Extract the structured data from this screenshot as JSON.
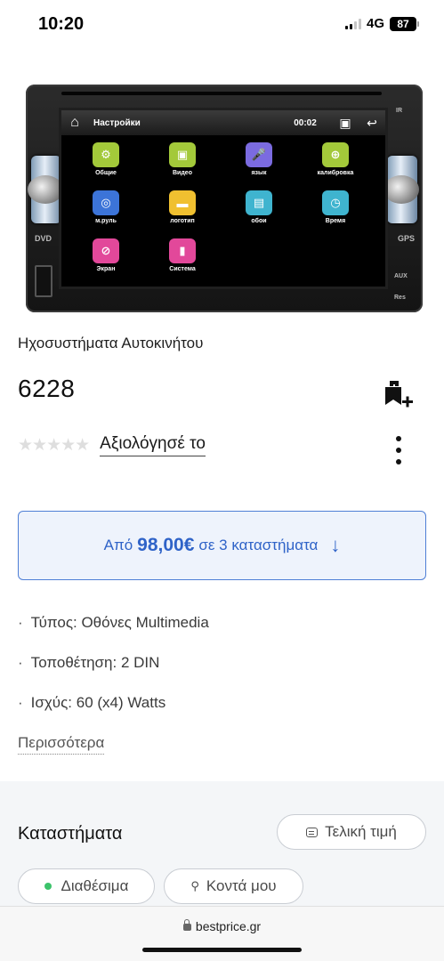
{
  "status_bar": {
    "time": "10:20",
    "network": "4G",
    "battery": "87"
  },
  "product_image": {
    "screen_title": "Настройки",
    "screen_clock": "00:02",
    "labels": {
      "dvd": "DVD",
      "gps": "GPS",
      "aux": "AUX",
      "res": "Res",
      "ir": "IR"
    },
    "apps": [
      {
        "label": "Общие",
        "icon": "gear-icon",
        "color": "#a3c93a",
        "glyph": "⚙"
      },
      {
        "label": "Видео",
        "icon": "video-icon",
        "color": "#a3c93a",
        "glyph": "▣"
      },
      {
        "label": "язык",
        "icon": "microphone-icon",
        "color": "#7b6be0",
        "glyph": "🎤"
      },
      {
        "label": "калибровка",
        "icon": "target-icon",
        "color": "#a3c93a",
        "glyph": "⊕"
      },
      {
        "label": "м.руль",
        "icon": "steering-wheel-icon",
        "color": "#3c74d8",
        "glyph": "◎"
      },
      {
        "label": "логотип",
        "icon": "car-icon",
        "color": "#f0c030",
        "glyph": "▬"
      },
      {
        "label": "обои",
        "icon": "wallpaper-icon",
        "color": "#3fb4cf",
        "glyph": "▤"
      },
      {
        "label": "Время",
        "icon": "clock-icon",
        "color": "#3fb4cf",
        "glyph": "◷"
      },
      {
        "label": "Экран",
        "icon": "screen-icon",
        "color": "#e2489a",
        "glyph": "⊘"
      },
      {
        "label": "Система",
        "icon": "system-icon",
        "color": "#e2489a",
        "glyph": "▮"
      }
    ]
  },
  "product": {
    "category": "Ηχοσυστήματα Αυτοκινήτου",
    "title": "6228",
    "rate_label": "Αξιολόγησέ το",
    "stars": "★★★★★"
  },
  "offers": {
    "prefix": "Από",
    "price": "98,00€",
    "suffix": "σε 3 καταστήματα",
    "arrow": "↓"
  },
  "specs": [
    {
      "text": "Τύπος: Οθόνες Multimedia"
    },
    {
      "text": "Τοποθέτηση: 2 DIN"
    },
    {
      "text": "Ισχύς: 60 (x4) Watts"
    }
  ],
  "more_label": "Περισσότερα",
  "stores": {
    "title": "Καταστήματα",
    "final_price_label": "Τελική τιμή",
    "available_label": "Διαθέσιμα",
    "near_label": "Κοντά μου"
  },
  "browser": {
    "url": "bestprice.gr"
  },
  "colors": {
    "accent": "#2f63c8",
    "offers_bg": "#eef3fc",
    "available": "#3cc36b"
  }
}
